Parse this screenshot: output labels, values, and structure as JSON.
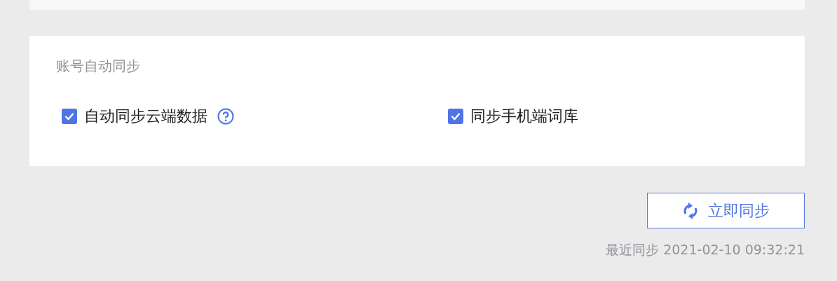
{
  "section": {
    "title": "账号自动同步"
  },
  "options": [
    {
      "label": "自动同步云端数据",
      "checked": true,
      "help": true
    },
    {
      "label": "同步手机端词库",
      "checked": true,
      "help": false
    }
  ],
  "sync_button": {
    "label": "立即同步"
  },
  "last_sync": "最近同步 2021-02-10 09:32:21"
}
